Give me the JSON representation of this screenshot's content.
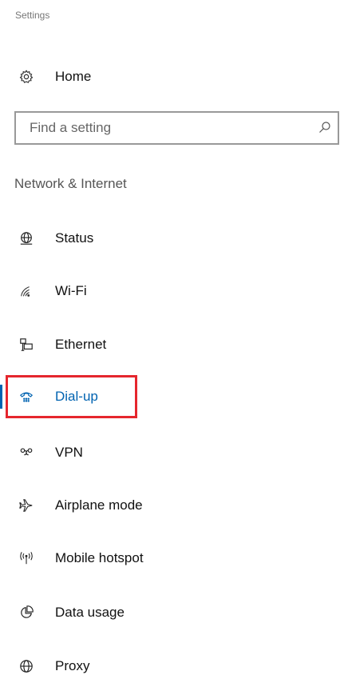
{
  "app": {
    "title": "Settings"
  },
  "home": {
    "label": "Home",
    "icon": "gear-icon"
  },
  "search": {
    "placeholder": "Find a setting",
    "value": "",
    "icon": "search-icon"
  },
  "section": {
    "heading": "Network & Internet"
  },
  "nav": {
    "items": [
      {
        "label": "Status",
        "icon": "globe-status-icon",
        "active": false
      },
      {
        "label": "Wi-Fi",
        "icon": "wifi-icon",
        "active": false
      },
      {
        "label": "Ethernet",
        "icon": "ethernet-icon",
        "active": false
      },
      {
        "label": "Dial-up",
        "icon": "dialup-phone-icon",
        "active": true
      },
      {
        "label": "VPN",
        "icon": "vpn-icon",
        "active": false
      },
      {
        "label": "Airplane mode",
        "icon": "airplane-icon",
        "active": false
      },
      {
        "label": "Mobile hotspot",
        "icon": "hotspot-icon",
        "active": false
      },
      {
        "label": "Data usage",
        "icon": "pie-chart-icon",
        "active": false
      },
      {
        "label": "Proxy",
        "icon": "globe-icon",
        "active": false
      }
    ]
  },
  "colors": {
    "accent": "#0063b1",
    "highlight_border": "#e5262d",
    "text_secondary": "#777777"
  }
}
